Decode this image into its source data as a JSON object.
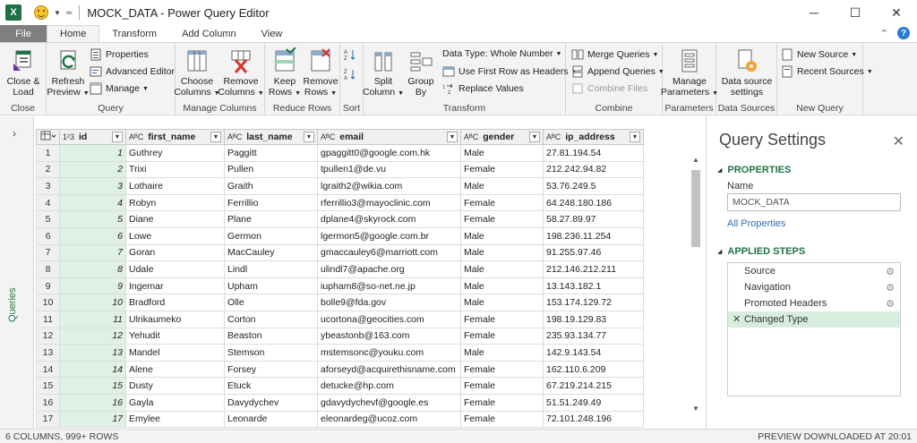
{
  "window": {
    "title": "MOCK_DATA - Power Query Editor",
    "app_logo": "X",
    "minimize": "─",
    "maximize": "☐",
    "close": "✕"
  },
  "tabs": {
    "file": "File",
    "items": [
      "Home",
      "Transform",
      "Add Column",
      "View"
    ],
    "active": "Home",
    "help": "?"
  },
  "ribbon": {
    "close": {
      "btn1": "Close &",
      "btn1b": "Load",
      "label": "Close"
    },
    "query": {
      "refresh": "Refresh",
      "refresh_b": "Preview",
      "properties": "Properties",
      "advanced_editor": "Advanced Editor",
      "manage": "Manage",
      "label": "Query"
    },
    "manage_columns": {
      "choose": "Choose",
      "choose_b": "Columns",
      "remove": "Remove",
      "remove_b": "Columns",
      "label": "Manage Columns"
    },
    "reduce_rows": {
      "keep": "Keep",
      "keep_b": "Rows",
      "remove": "Remove",
      "remove_b": "Rows",
      "label": "Reduce Rows"
    },
    "sort": {
      "label": "Sort"
    },
    "transform": {
      "split": "Split",
      "split_b": "Column",
      "group": "Group",
      "group_b": "By",
      "data_type": "Data Type: Whole Number",
      "first_row": "Use First Row as Headers",
      "replace": "Replace Values",
      "label": "Transform"
    },
    "combine": {
      "merge": "Merge Queries",
      "append": "Append Queries",
      "combine_files": "Combine Files",
      "label": "Combine"
    },
    "parameters": {
      "manage": "Manage",
      "manage_b": "Parameters",
      "label": "Parameters"
    },
    "data_sources": {
      "settings": "Data source",
      "settings_b": "settings",
      "label": "Data Sources"
    },
    "new_query": {
      "new_source": "New Source",
      "recent_sources": "Recent Sources",
      "label": "New Query"
    }
  },
  "queries_panel": {
    "label": "Queries",
    "chevron": "›"
  },
  "grid": {
    "columns": [
      {
        "type": "1²3",
        "name": "id"
      },
      {
        "type": "AᴮC",
        "name": "first_name"
      },
      {
        "type": "AᴮC",
        "name": "last_name"
      },
      {
        "type": "AᴮC",
        "name": "email"
      },
      {
        "type": "AᴮC",
        "name": "gender"
      },
      {
        "type": "AᴮC",
        "name": "ip_address"
      }
    ],
    "rows": [
      [
        "1",
        "1",
        "Guthrey",
        "Paggitt",
        "gpaggitt0@google.com.hk",
        "Male",
        "27.81.194.54"
      ],
      [
        "2",
        "2",
        "Trixi",
        "Pullen",
        "tpullen1@de.vu",
        "Female",
        "212.242.94.82"
      ],
      [
        "3",
        "3",
        "Lothaire",
        "Graith",
        "lgraith2@wikia.com",
        "Male",
        "53.76.249.5"
      ],
      [
        "4",
        "4",
        "Robyn",
        "Ferrillio",
        "rferrillio3@mayoclinic.com",
        "Female",
        "64.248.180.186"
      ],
      [
        "5",
        "5",
        "Diane",
        "Plane",
        "dplane4@skyrock.com",
        "Female",
        "58.27.89.97"
      ],
      [
        "6",
        "6",
        "Lowe",
        "Germon",
        "lgermon5@google.com.br",
        "Male",
        "198.236.11.254"
      ],
      [
        "7",
        "7",
        "Goran",
        "MacCauley",
        "gmaccauley6@marriott.com",
        "Male",
        "91.255.97.46"
      ],
      [
        "8",
        "8",
        "Udale",
        "Lindl",
        "ulindl7@apache.org",
        "Male",
        "212.146.212.211"
      ],
      [
        "9",
        "9",
        "Ingemar",
        "Upham",
        "iupham8@so-net.ne.jp",
        "Male",
        "13.143.182.1"
      ],
      [
        "10",
        "10",
        "Bradford",
        "Olle",
        "bolle9@fda.gov",
        "Male",
        "153.174.129.72"
      ],
      [
        "11",
        "11",
        "Ulrikaumeko",
        "Corton",
        "ucortona@geocities.com",
        "Female",
        "198.19.129.83"
      ],
      [
        "12",
        "12",
        "Yehudit",
        "Beaston",
        "ybeastonb@163.com",
        "Female",
        "235.93.134.77"
      ],
      [
        "13",
        "13",
        "Mandel",
        "Stemson",
        "mstemsonc@youku.com",
        "Male",
        "142.9.143.54"
      ],
      [
        "14",
        "14",
        "Alene",
        "Forsey",
        "aforseyd@acquirethisname.com",
        "Female",
        "162.110.6.209"
      ],
      [
        "15",
        "15",
        "Dusty",
        "Etuck",
        "detucke@hp.com",
        "Female",
        "67.219.214.215"
      ],
      [
        "16",
        "16",
        "Gayla",
        "Davydychev",
        "gdavydychevf@google.es",
        "Female",
        "51.51.249.49"
      ],
      [
        "17",
        "17",
        "Emylee",
        "Leonarde",
        "eleonardeg@ucoz.com",
        "Female",
        "72.101.248.196"
      ]
    ]
  },
  "settings": {
    "title": "Query Settings",
    "close": "✕",
    "properties_header": "PROPERTIES",
    "name_label": "Name",
    "name_value": "MOCK_DATA",
    "all_properties": "All Properties",
    "steps_header": "APPLIED STEPS",
    "steps": [
      "Source",
      "Navigation",
      "Promoted Headers",
      "Changed Type"
    ],
    "selected_step": "Changed Type"
  },
  "status": {
    "left": "6 COLUMNS, 999+ ROWS",
    "right": "PREVIEW DOWNLOADED AT 20:01"
  }
}
